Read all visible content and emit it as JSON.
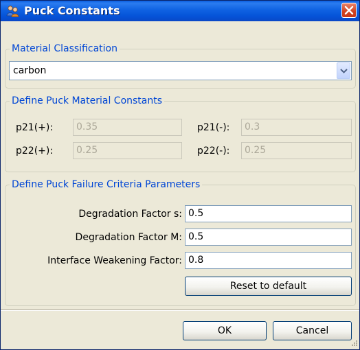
{
  "window": {
    "title": "Puck Constants"
  },
  "material_classification": {
    "legend": "Material Classification",
    "selected": "carbon"
  },
  "constants": {
    "legend": "Define Puck Material Constants",
    "p21_plus": {
      "label": "p21(+):",
      "value": "0.35"
    },
    "p21_minus": {
      "label": "p21(-):",
      "value": "0.3"
    },
    "p22_plus": {
      "label": "p22(+):",
      "value": "0.25"
    },
    "p22_minus": {
      "label": "p22(-):",
      "value": "0.25"
    }
  },
  "failure_criteria": {
    "legend": "Define Puck Failure Criteria Parameters",
    "degradation_s": {
      "label": "Degradation Factor s:",
      "value": "0.5"
    },
    "degradation_m": {
      "label": "Degradation Factor M:",
      "value": "0.5"
    },
    "interface_weakening": {
      "label": "Interface Weakening Factor:",
      "value": "0.8"
    },
    "reset_label": "Reset to default"
  },
  "footer": {
    "ok_label": "OK",
    "cancel_label": "Cancel"
  },
  "icons": {
    "title": "people-icon",
    "close": "close-icon",
    "dropdown": "chevron-down-icon"
  },
  "colors": {
    "titlebar": "#0553d8",
    "legend_text": "#0046d5",
    "dialog_bg": "#ece9d8",
    "close_button": "#d0421f"
  }
}
